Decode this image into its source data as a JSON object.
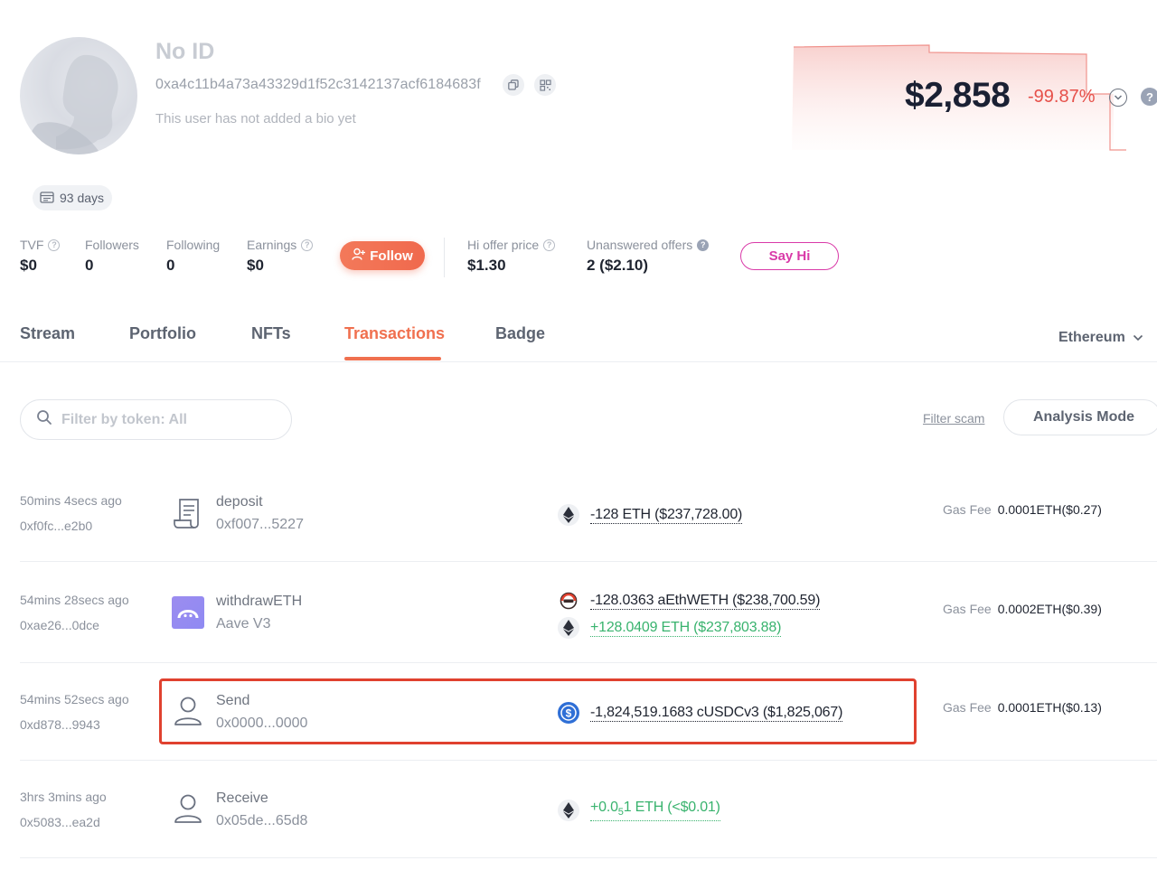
{
  "profile": {
    "name": "No ID",
    "address": "0xa4c11b4a73a43329d1f52c3142137acf6184683f",
    "bio": "This user has not added a bio yet",
    "days_badge": "93 days"
  },
  "value": {
    "amount": "$2,858",
    "change": "-99.87%",
    "change_color": "#e6504a"
  },
  "stats": [
    {
      "label": "TVF",
      "value": "$0"
    },
    {
      "label": "Followers",
      "value": "0"
    },
    {
      "label": "Following",
      "value": "0"
    },
    {
      "label": "Earnings",
      "value": "$0"
    },
    {
      "label": "Hi offer price",
      "value": "$1.30"
    },
    {
      "label": "Unanswered offers",
      "value": "2 ($2.10)"
    }
  ],
  "buttons": {
    "follow": "Follow",
    "say_hi": "Say Hi",
    "filter_scam": "Filter scam",
    "analysis_mode": "Analysis Mode"
  },
  "tabs": [
    "Stream",
    "Portfolio",
    "NFTs",
    "Transactions",
    "Badge"
  ],
  "active_tab": "Transactions",
  "chain": "Ethereum",
  "filter": {
    "placeholder": "Filter by token: All"
  },
  "transactions": [
    {
      "time": "50mins 4secs ago",
      "hash": "0xf0fc...e2b0",
      "icon": "contract-scroll-icon",
      "method": "deposit",
      "target": "0xf007...5227",
      "amounts": [
        {
          "token_icon": "eth-icon",
          "text": "-128 ETH ($237,728.00)",
          "direction": "out"
        }
      ],
      "gas_label": "Gas Fee",
      "gas_value": "0.0001ETH($0.27)"
    },
    {
      "time": "54mins 28secs ago",
      "hash": "0xae26...0dce",
      "icon": "aave-logo-icon",
      "method": "withdrawETH",
      "target": "Aave V3",
      "amounts": [
        {
          "token_icon": "aethweth-icon",
          "text": "-128.0363 aEthWETH ($238,700.59)",
          "direction": "out"
        },
        {
          "token_icon": "eth-icon",
          "text": "+128.0409 ETH ($237,803.88)",
          "direction": "in"
        }
      ],
      "gas_label": "Gas Fee",
      "gas_value": "0.0002ETH($0.39)"
    },
    {
      "time": "54mins 52secs ago",
      "hash": "0xd878...9943",
      "icon": "user-icon",
      "method": "Send",
      "target": "0x0000...0000",
      "amounts": [
        {
          "token_icon": "usdc-icon",
          "text": "-1,824,519.1683 cUSDCv3 ($1,825,067)",
          "direction": "out"
        }
      ],
      "gas_label": "Gas Fee",
      "gas_value": "0.0001ETH($0.13)"
    },
    {
      "time": "3hrs 3mins ago",
      "hash": "0x5083...ea2d",
      "icon": "user-icon",
      "method": "Receive",
      "target": "0x05de...65d8",
      "amounts": [
        {
          "token_icon": "eth-icon",
          "text_prefix": "+0.0",
          "text_sub": "5",
          "text_suffix": "1 ETH (<$0.01)",
          "direction": "in"
        }
      ],
      "gas_label": "",
      "gas_value": ""
    }
  ]
}
